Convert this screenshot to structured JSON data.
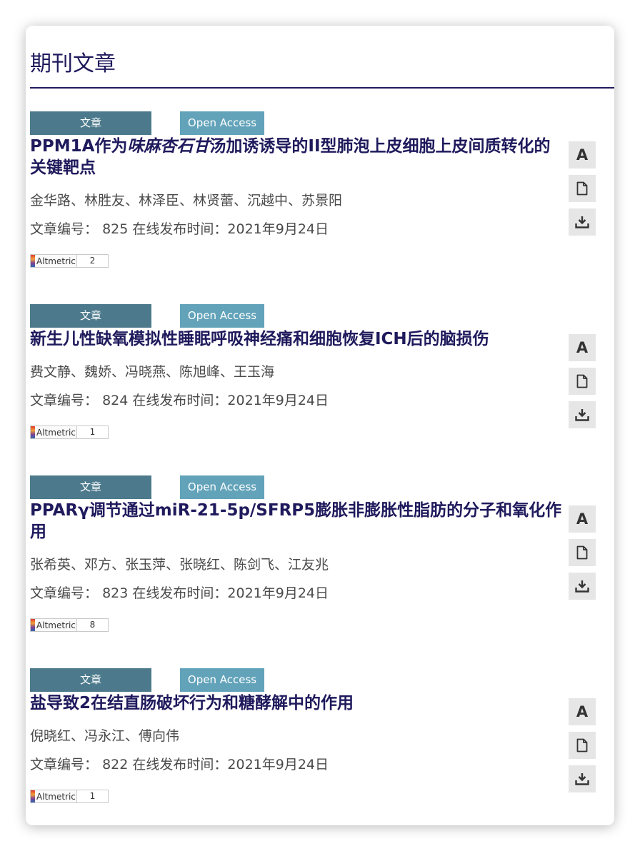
{
  "page": {
    "title": "期刊文章"
  },
  "labels": {
    "article_number": "文章编号：",
    "published_online": "在线发布时间：",
    "altmetric_logo": "Altmetric",
    "font_tool_letter": "A"
  },
  "icons": {
    "font": "font-size-icon",
    "pdf": "document-icon",
    "download": "download-icon"
  },
  "colors": {
    "title": "#1f1a5c",
    "badge_type": "#4c7a8c",
    "badge_open_access": "#62a3ba",
    "tool_button": "#e6e6e6"
  },
  "articles": [
    {
      "type": "文章",
      "access": "Open Access",
      "title_pre": "PPM1A作为",
      "title_italic": "味麻杏石甘",
      "title_post": "汤加诱诱导的II型肺泡上皮细胞上皮间质转化的关键靶点",
      "authors": "金华路、林胜友、林泽臣、林贤蕾、沉越中、苏景阳",
      "number": "825",
      "date": "2021年9月24日",
      "altmetric": "2"
    },
    {
      "type": "文章",
      "access": "Open Access",
      "title_pre": "新生儿性缺氧模拟性睡眠呼吸神经痛和细胞恢复ICH后的脑损伤",
      "title_italic": "",
      "title_post": "",
      "authors": "费文静、魏娇、冯晓燕、陈旭峰、王玉海",
      "number": "824",
      "date": "2021年9月24日",
      "altmetric": "1"
    },
    {
      "type": "文章",
      "access": "Open Access",
      "title_pre": "PPARγ调节通过miR-21-5p/SFRP5膨胀非膨胀性脂肪的分子和氧化作用",
      "title_italic": "",
      "title_post": "",
      "authors": "张希英、邓方、张玉萍、张晓红、陈剑飞、江友兆",
      "number": "823",
      "date": "2021年9月24日",
      "altmetric": "8"
    },
    {
      "type": "文章",
      "access": "Open Access",
      "title_pre": "盐导致2在结直肠破坏行为和糖酵解中的作用",
      "title_italic": "",
      "title_post": "",
      "authors": "倪晓红、冯永江、傅向伟",
      "number": "822",
      "date": "2021年9月24日",
      "altmetric": "1"
    }
  ]
}
